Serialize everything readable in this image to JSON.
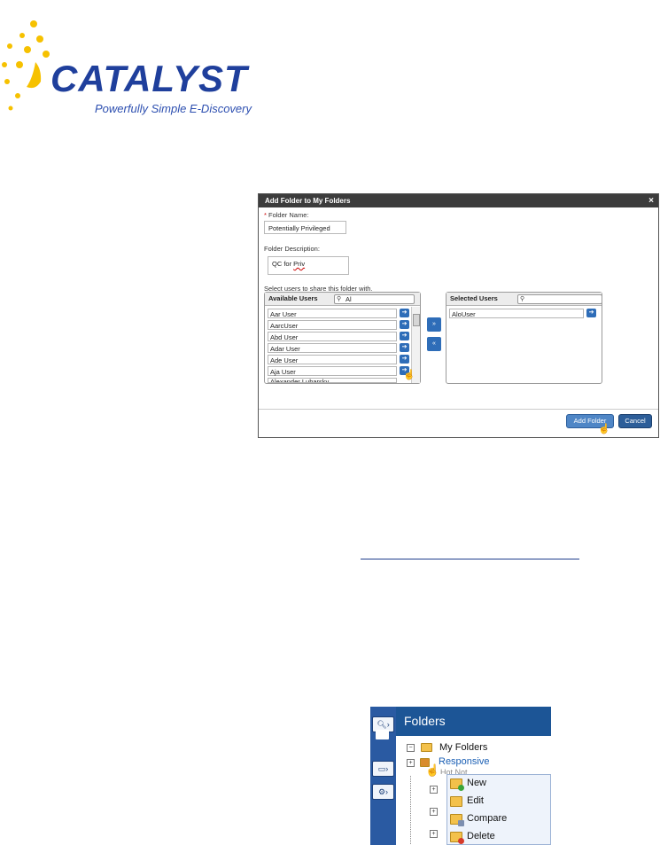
{
  "logo": {
    "word": "CATALYST",
    "tagline": "Powerfully Simple E-Discovery"
  },
  "dialog": {
    "title": "Add Folder to My Folders",
    "close": "×",
    "folder_name_label": "Folder Name:",
    "required_mark": "*",
    "folder_name_value": "Potentially Privileged",
    "folder_desc_label": "Folder Description:",
    "folder_desc_value_prefix": "QC for ",
    "folder_desc_value_word": "Priv",
    "share_label": "Select users to share this folder with.",
    "available": {
      "header": "Available Users",
      "search_value": "Al",
      "users": [
        "Aar User",
        "AarcUser",
        "Abd User",
        "Adar User",
        "Ade User",
        "Aja User",
        "Alexander Lubarsky"
      ]
    },
    "selected": {
      "header": "Selected Users",
      "search_value": "",
      "users": [
        "AloUser"
      ]
    },
    "move_right": "»",
    "move_left": "«",
    "add_button": "Add Folder",
    "cancel_button": "Cancel"
  },
  "folders": {
    "title": "Folders",
    "tree": {
      "my_folders": "My Folders",
      "responsive": "Responsive",
      "partial_below": "Hot Not"
    },
    "context_menu": [
      "New",
      "Edit",
      "Compare",
      "Delete"
    ],
    "colors": {
      "rail": "#2a5aa2",
      "header": "#1c5596",
      "menu_bg": "#eef3fb"
    }
  }
}
